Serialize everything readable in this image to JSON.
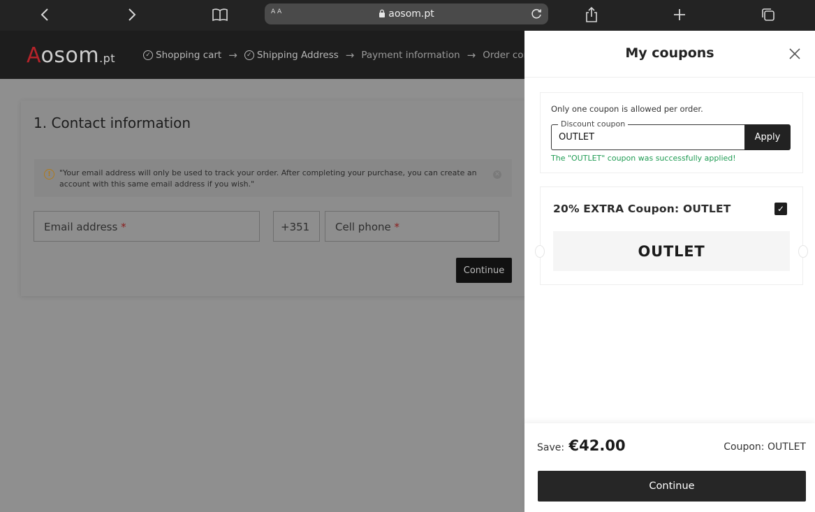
{
  "browser": {
    "url": "aosom.pt",
    "reader_label": "A A"
  },
  "site": {
    "logo_initial": "A",
    "logo_rest": "osom",
    "logo_tld": ".pt",
    "steps": [
      {
        "label": "Shopping cart",
        "done": true
      },
      {
        "label": "Shipping Address",
        "done": true
      },
      {
        "label": "Payment information",
        "done": false
      },
      {
        "label": "Order comp",
        "done": false
      }
    ]
  },
  "contact": {
    "title": "1. Contact information",
    "notice": "\"Your email address will only be used to track your order. After completing your purchase, you can create an account with this same email address if you wish.\"",
    "email_placeholder": "Email address",
    "country_code": "+351",
    "phone_placeholder": "Cell phone",
    "required_mark": "*",
    "continue_label": "Continue"
  },
  "coupons_panel": {
    "title": "My coupons",
    "rule": "Only one coupon is allowed per order.",
    "input_legend": "Discount coupon",
    "input_value": "OUTLET",
    "apply_label": "Apply",
    "success_message": "The \"OUTLET\" coupon was successfully applied!",
    "coupon": {
      "name": "20% EXTRA Coupon: OUTLET",
      "code": "OUTLET",
      "selected": true
    },
    "footer": {
      "save_label": "Save:",
      "save_amount": "€42.00",
      "coupon_label": "Coupon: OUTLET",
      "continue_label": "Continue"
    }
  },
  "colors": {
    "success": "#1e9b52",
    "brand_red": "#b5232a",
    "button_dark": "#262626"
  }
}
